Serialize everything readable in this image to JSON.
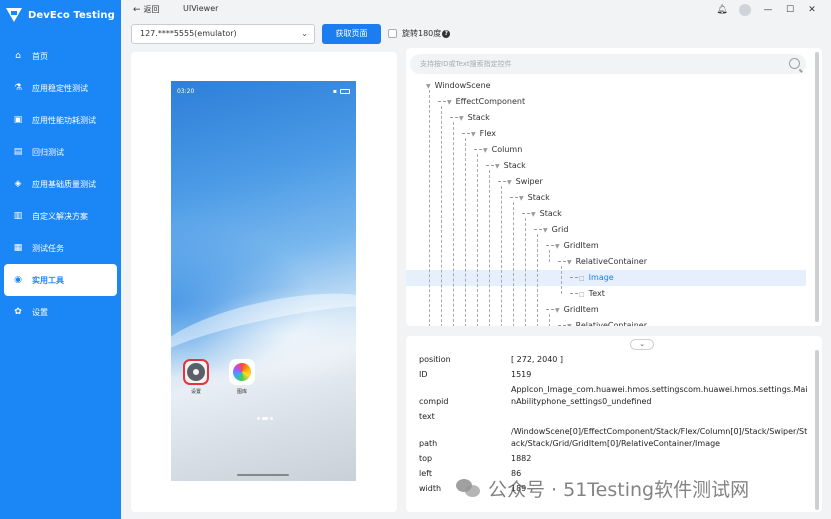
{
  "app": {
    "name": "DevEco Testing"
  },
  "sidebar": {
    "items": [
      {
        "label": "首页",
        "icon": "home-icon",
        "glyph": "⌂"
      },
      {
        "label": "应用稳定性测试",
        "icon": "stability-icon",
        "glyph": "⚗"
      },
      {
        "label": "应用性能功耗测试",
        "icon": "performance-icon",
        "glyph": "▣"
      },
      {
        "label": "回归测试",
        "icon": "regression-icon",
        "glyph": "▤"
      },
      {
        "label": "应用基础质量测试",
        "icon": "quality-icon",
        "glyph": "◈"
      },
      {
        "label": "自定义解决方案",
        "icon": "toolbox-icon",
        "glyph": "▥"
      },
      {
        "label": "测试任务",
        "icon": "task-icon",
        "glyph": "▦"
      },
      {
        "label": "实用工具",
        "icon": "tools-icon",
        "glyph": "◉",
        "active": true
      },
      {
        "label": "设置",
        "icon": "settings-icon",
        "glyph": "✿"
      }
    ]
  },
  "topbar": {
    "back_label": "返回",
    "breadcrumb": "UIViewer"
  },
  "device": {
    "selected": "127.****5555(emulator)",
    "fetch_label": "获取页面",
    "rotate_label": "旋转180度"
  },
  "phone": {
    "time": "03:20",
    "apps": [
      {
        "label": "设置"
      },
      {
        "label": "图库"
      }
    ]
  },
  "tree": {
    "search_placeholder": "支持按ID或Text搜索指定控件",
    "nodes": [
      {
        "label": "WindowScene",
        "depth": 0,
        "expanded": true
      },
      {
        "label": "EffectComponent",
        "depth": 1,
        "expanded": true
      },
      {
        "label": "Stack",
        "depth": 2,
        "expanded": true
      },
      {
        "label": "Flex",
        "depth": 3,
        "expanded": true
      },
      {
        "label": "Column",
        "depth": 4,
        "expanded": true
      },
      {
        "label": "Stack",
        "depth": 5,
        "expanded": true
      },
      {
        "label": "Swiper",
        "depth": 6,
        "expanded": true
      },
      {
        "label": "Stack",
        "depth": 7,
        "expanded": true
      },
      {
        "label": "Stack",
        "depth": 8,
        "expanded": true
      },
      {
        "label": "Grid",
        "depth": 9,
        "expanded": true
      },
      {
        "label": "GridItem",
        "depth": 10,
        "expanded": true
      },
      {
        "label": "RelativeContainer",
        "depth": 11,
        "expanded": true
      },
      {
        "label": "Image",
        "depth": 12,
        "expanded": false,
        "selected": true
      },
      {
        "label": "Text",
        "depth": 12,
        "expanded": false
      },
      {
        "label": "GridItem",
        "depth": 10,
        "expanded": true
      },
      {
        "label": "RelativeContainer",
        "depth": 11,
        "expanded": true
      }
    ]
  },
  "properties": [
    {
      "key": "position",
      "value": "[ 272, 2040 ]"
    },
    {
      "key": "ID",
      "value": "1519"
    },
    {
      "key": "compid",
      "value": "AppIcon_Image_com.huawei.hmos.settingscom.huawei.hmos.settings.MainAbilityphone_settings0_undefined"
    },
    {
      "key": "text",
      "value": ""
    },
    {
      "key": "path",
      "value": "/WindowScene[0]/EffectComponent/Stack/Flex/Column[0]/Stack/Swiper/Stack/Stack/Grid/GridItem[0]/RelativeContainer/Image"
    },
    {
      "key": "top",
      "value": "1882"
    },
    {
      "key": "left",
      "value": "86"
    },
    {
      "key": "width",
      "value": "189"
    }
  ],
  "watermark": "公众号 · 51Testing软件测试网",
  "colors": {
    "accent": "#1b86f5",
    "button": "#1b7df0",
    "selection": "#e6f0fc"
  }
}
